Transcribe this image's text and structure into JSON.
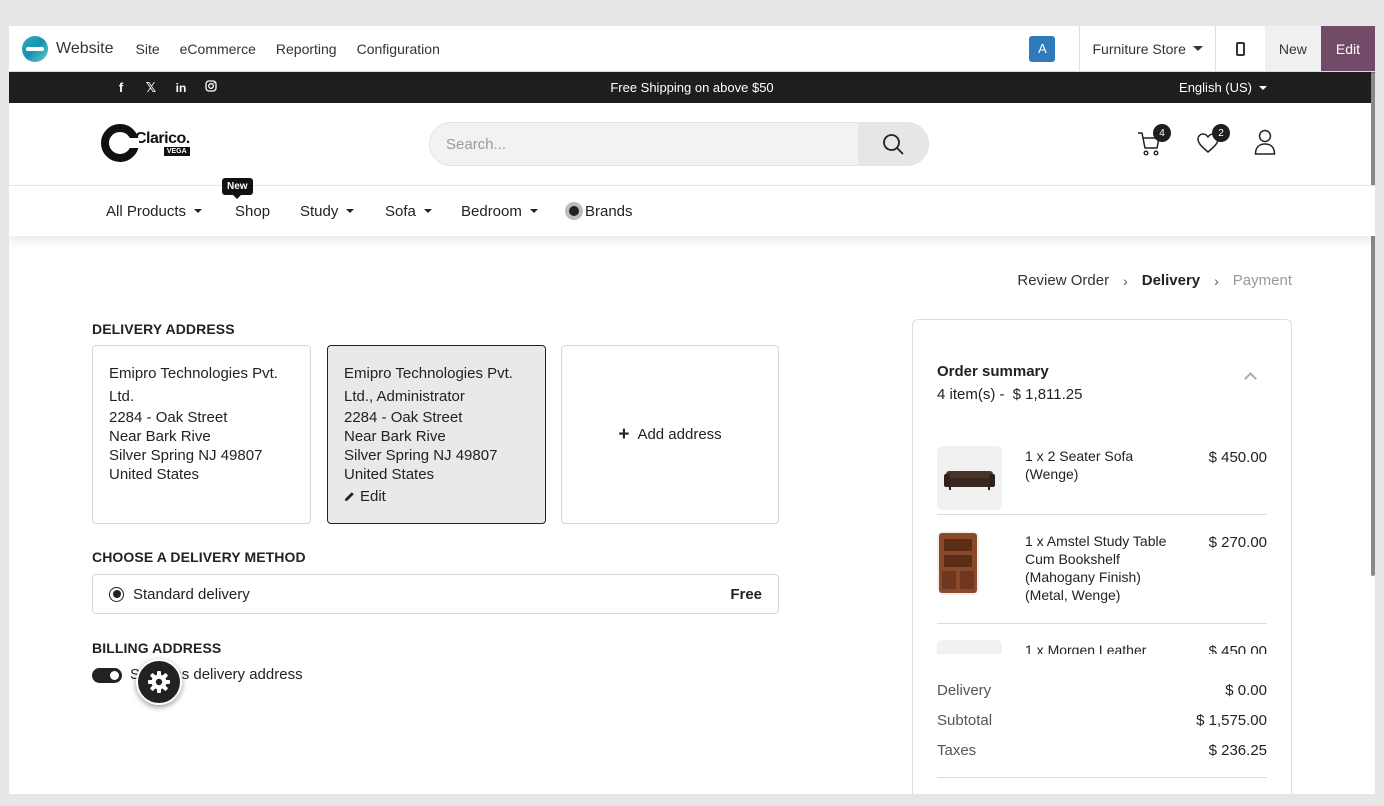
{
  "admin_bar": {
    "app_name": "Website",
    "menu": [
      "Site",
      "eCommerce",
      "Reporting",
      "Configuration"
    ],
    "user_initial": "A",
    "store": "Furniture Store",
    "new_label": "New",
    "edit_label": "Edit",
    "edit_color": "#714b67"
  },
  "top_bar": {
    "social": [
      "facebook",
      "x-twitter",
      "linkedin",
      "instagram"
    ],
    "announcement": "Free Shipping on above $50",
    "language": "English (US)"
  },
  "header": {
    "logo_word": "Clarico.",
    "logo_sub": "VEGA",
    "search_placeholder": "Search...",
    "cart_count": "4",
    "wishlist_count": "2"
  },
  "nav": {
    "items": [
      "All Products",
      "Shop",
      "Study",
      "Sofa",
      "Bedroom",
      "Brands"
    ],
    "new_tag": "New"
  },
  "steps": {
    "review": "Review Order",
    "delivery": "Delivery",
    "payment": "Payment"
  },
  "delivery_address": {
    "title": "DELIVERY ADDRESS",
    "card1": {
      "name": "Emipro Technologies Pvt. Ltd.",
      "street": "2284 - Oak Street",
      "street2": "Near Bark Rive",
      "city": "Silver Spring NJ 49807",
      "country": "United States"
    },
    "card2": {
      "name": "Emipro Technologies Pvt. Ltd., Administrator",
      "street": "2284 - Oak Street",
      "street2": "Near Bark Rive",
      "city": "Silver Spring NJ 49807",
      "country": "United States",
      "edit": "Edit"
    },
    "add_label": "Add address"
  },
  "delivery_method": {
    "title": "CHOOSE A DELIVERY METHOD",
    "option": "Standard delivery",
    "price": "Free"
  },
  "billing": {
    "title": "BILLING ADDRESS",
    "toggle_label": "Same as delivery address"
  },
  "summary": {
    "title": "Order summary",
    "items_count": "4 item(s) -",
    "total": "$ 1,811.25",
    "items": [
      {
        "name": "1 x 2 Seater Sofa (Wenge)",
        "price": "$ 450.00"
      },
      {
        "name": "1 x Amstel Study Table Cum Bookshelf (Mahogany Finish) (Metal, Wenge)",
        "price": "$ 270.00"
      },
      {
        "name": "1 x Morgen Leather",
        "price": "$ 450.00"
      }
    ],
    "totals": [
      {
        "label": "Delivery",
        "value": "$ 0.00"
      },
      {
        "label": "Subtotal",
        "value": "$ 1,575.00"
      },
      {
        "label": "Taxes",
        "value": "$ 236.25"
      }
    ]
  }
}
